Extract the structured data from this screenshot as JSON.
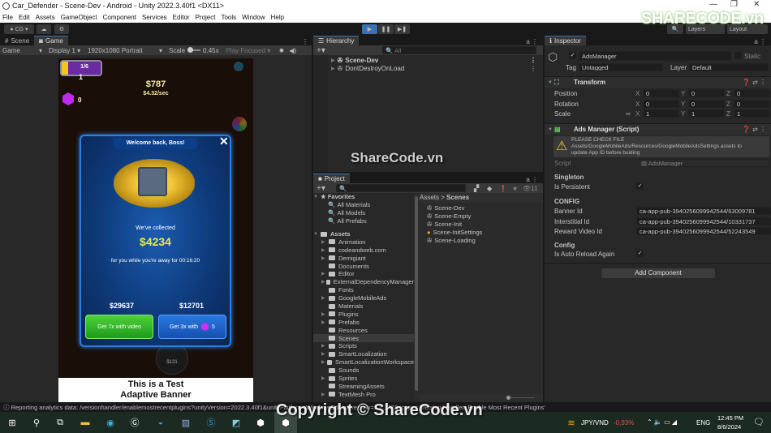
{
  "window": {
    "title": "Car_Defender - Scene-Dev - Android - Unity 2022.3.40f1 <DX11>",
    "controls": [
      "—",
      "❐",
      "✕"
    ]
  },
  "menu": [
    "File",
    "Edit",
    "Assets",
    "GameObject",
    "Component",
    "Services",
    "Editor",
    "Project",
    "Tools",
    "Window",
    "Help"
  ],
  "toolbar": {
    "account": "CG",
    "play": "▶",
    "pause": "❚❚",
    "step": "▶❚",
    "layers": "Layers",
    "layout": "Layout"
  },
  "game_panel": {
    "tabs": [
      {
        "label": "Scene",
        "icon": "#"
      },
      {
        "label": "Game",
        "icon": "🎮"
      }
    ],
    "mode": "Game",
    "display": "Display 1",
    "resolution": "1920x1080 Portrait",
    "scale_label": "Scale",
    "scale_value": "0.45x",
    "play_focused": "Play Focused"
  },
  "game": {
    "level": "1/6",
    "level_sub": "1",
    "money": "$787",
    "rate": "$4.32/sec",
    "gems": "0",
    "popup": {
      "title": "Welcome back, Boss!",
      "collected_label": "We've collected",
      "collected_amount": "$4234",
      "away_text": "for you while you're away for 00:16:20",
      "reward_video_amount": "$29637",
      "reward_gem_amount": "$12701",
      "video_button": "Get 7x with video",
      "gem_button": "Get 3x with",
      "gem_cost": "5"
    },
    "bottom_price": "$131",
    "banner_line1": "This is a Test",
    "banner_line2": "Adaptive Banner"
  },
  "hierarchy": {
    "tab": "Hierarchy",
    "search_placeholder": "All",
    "items": [
      "Scene-Dev",
      "DontDestroyOnLoad"
    ]
  },
  "project": {
    "tab": "Project",
    "hidden_count": "11",
    "favorites_label": "Favorites",
    "favorites": [
      "All Materials",
      "All Models",
      "All Prefabs"
    ],
    "assets_label": "Assets",
    "folders": [
      {
        "name": "Animation",
        "expandable": true
      },
      {
        "name": "codeandweb.com",
        "expandable": true
      },
      {
        "name": "Demigiant",
        "expandable": true
      },
      {
        "name": "Documents",
        "expandable": false
      },
      {
        "name": "Editor",
        "expandable": true
      },
      {
        "name": "ExternalDependencyManager",
        "expandable": true
      },
      {
        "name": "Fonts",
        "expandable": false
      },
      {
        "name": "GoogleMobileAds",
        "expandable": true
      },
      {
        "name": "Materials",
        "expandable": false
      },
      {
        "name": "Plugins",
        "expandable": true
      },
      {
        "name": "Prefabs",
        "expandable": true
      },
      {
        "name": "Resources",
        "expandable": false
      },
      {
        "name": "Scenes",
        "expandable": false,
        "selected": true
      },
      {
        "name": "Scripts",
        "expandable": true
      },
      {
        "name": "SmartLocalization",
        "expandable": true
      },
      {
        "name": "SmartLocalizationWorkspace",
        "expandable": true
      },
      {
        "name": "Sounds",
        "expandable": false
      },
      {
        "name": "Sprites",
        "expandable": true
      },
      {
        "name": "StreamingAssets",
        "expandable": false
      },
      {
        "name": "TextMesh Pro",
        "expandable": true
      }
    ],
    "breadcrumb": [
      "Assets",
      "Scenes"
    ],
    "files": [
      "Scene-Dev",
      "Scene-Empty",
      "Scene-Init",
      "Scene-InitSettings",
      "Scene-Loading"
    ]
  },
  "inspector": {
    "tab": "Inspector",
    "object_name": "AdsManager",
    "static_label": "Static",
    "tag_label": "Tag",
    "tag_value": "Untagged",
    "layer_label": "Layer",
    "layer_value": "Default",
    "transform": {
      "title": "Transform",
      "rows": [
        {
          "label": "Position",
          "x": "0",
          "y": "0",
          "z": "0"
        },
        {
          "label": "Rotation",
          "x": "0",
          "y": "0",
          "z": "0"
        },
        {
          "label": "Scale",
          "x": "1",
          "y": "1",
          "z": "1"
        }
      ]
    },
    "script": {
      "title": "Ads Manager (Script)",
      "warning_line1": "PLEASE CHECK FILE",
      "warning_line2": "Assets/GoogleMobileAds/Resources/GoogleMobileAdsSettings.assets to",
      "warning_line3": "update App ID before buiding",
      "script_label": "Script",
      "script_value": "AdsManager",
      "singleton_header": "Singleton",
      "is_persistent_label": "Is Persistent",
      "is_persistent": true,
      "config_header": "CONFIG",
      "banner_label": "Banner Id",
      "banner_value": "ca-app-pub-3940256099942544/63009781",
      "interstitial_label": "Interstitial Id",
      "interstitial_value": "ca-app-pub-3940256099942544/10331737",
      "reward_label": "Reward Video Id",
      "reward_value": "ca-app-pub-3940256099942544/52243549",
      "config2_header": "Config",
      "auto_reload_label": "Is Auto Reload Again",
      "auto_reload": true
    },
    "add_component": "Add Component"
  },
  "status": {
    "message": "Reporting analytics data: /versionhandler/enablemostrecentplugins?unityVersion=2022.3.40f1&unityPlatform=WindowsEditor&version=1.2.177&scope= 'Version Handler: Enable Most Recent Plugins'"
  },
  "taskbar": {
    "ticker": "JPY/VND",
    "ticker_change": "-0,93%",
    "ticker_color": "#e05050",
    "language": "ENG",
    "time": "12:45 PM",
    "date": "8/6/2024"
  },
  "watermarks": {
    "logo": "SHARECODE.vn",
    "center": "ShareCode.vn",
    "bottom": "Copyright © ShareCode.vn"
  }
}
